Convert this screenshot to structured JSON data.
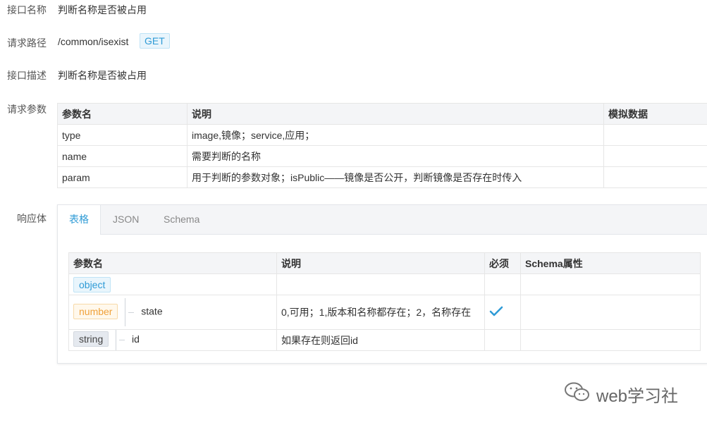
{
  "api_name": {
    "label": "接口名称",
    "value": "判断名称是否被占用"
  },
  "request_path": {
    "label": "请求路径",
    "value": "/common/isexist",
    "method": "GET"
  },
  "api_desc": {
    "label": "接口描述",
    "value": "判断名称是否被占用"
  },
  "request_params": {
    "label": "请求参数",
    "headers": [
      "参数名",
      "说明",
      "模拟数据"
    ],
    "rows": [
      {
        "name": "type",
        "desc": "image,镜像；service,应用；",
        "mock": ""
      },
      {
        "name": "name",
        "desc": "需要判断的名称",
        "mock": ""
      },
      {
        "name": "param",
        "desc": "用于判断的参数对象；isPublic——镜像是否公开，判断镜像是否存在时传入",
        "mock": ""
      }
    ]
  },
  "response": {
    "label": "响应体",
    "tabs": [
      "表格",
      "JSON",
      "Schema"
    ],
    "active_tab": "表格",
    "headers": [
      "参数名",
      "说明",
      "必须",
      "Schema属性"
    ],
    "rows": [
      {
        "type": "object",
        "name": "",
        "desc": "",
        "required": false,
        "schema": ""
      },
      {
        "type": "number",
        "name": "state",
        "desc": "0,可用；1,版本和名称都存在；2，名称存在",
        "required": true,
        "schema": ""
      },
      {
        "type": "string",
        "name": "id",
        "desc": "如果存在则返回id",
        "required": false,
        "schema": ""
      }
    ]
  },
  "watermark": {
    "text": "web学习社",
    "icon": "wechat-icon"
  },
  "colors": {
    "accent": "#2f9bd6",
    "number_tag": "#f0a23b",
    "header_bg": "#f4f5f7"
  }
}
